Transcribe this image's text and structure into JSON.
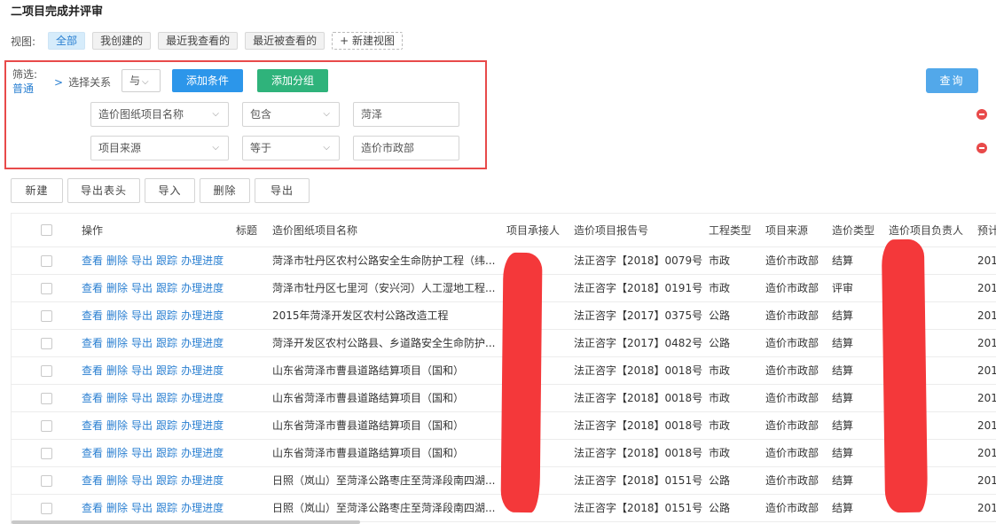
{
  "page": {
    "title": "二项目完成并评审"
  },
  "views": {
    "label": "视图:",
    "items": [
      "全部",
      "我创建的",
      "最近我查看的",
      "最近被查看的"
    ],
    "new_view": "+ 新建视图"
  },
  "filter": {
    "label": "筛选:",
    "mode": "普通",
    "relation_label": "选择关系",
    "relation_value": "与",
    "add_condition": "添加条件",
    "add_group": "添加分组",
    "conditions": [
      {
        "field": "造价图纸项目名称",
        "operator": "包含",
        "value": "菏泽"
      },
      {
        "field": "项目来源",
        "operator": "等于",
        "value": "造价市政部"
      }
    ],
    "query": "查询"
  },
  "toolbar": {
    "new": "新建",
    "export_header": "导出表头",
    "import": "导入",
    "delete": "删除",
    "export": "导出"
  },
  "table": {
    "columns": [
      "操作",
      "标题",
      "造价图纸项目名称",
      "项目承接人",
      "造价项目报告号",
      "工程类型",
      "项目来源",
      "造价类型",
      "造价项目负责人",
      "预计"
    ],
    "actions": [
      "查看",
      "删除",
      "导出",
      "跟踪",
      "办理进度"
    ],
    "rows": [
      {
        "name": "菏泽市牡丹区农村公路安全生命防护工程（纬...",
        "report": "法正咨字【2018】0079号",
        "type": "市政",
        "source": "造价市政部",
        "cost_type": "结算",
        "date": "201"
      },
      {
        "name": "菏泽市牡丹区七里河（安兴河）人工湿地工程...",
        "report": "法正咨字【2018】0191号",
        "type": "市政",
        "source": "造价市政部",
        "cost_type": "评审",
        "date": "201"
      },
      {
        "name": "2015年菏泽开发区农村公路改造工程",
        "report": "法正咨字【2017】0375号",
        "type": "公路",
        "source": "造价市政部",
        "cost_type": "结算",
        "date": "201"
      },
      {
        "name": "菏泽开发区农村公路县、乡道路安全生命防护...",
        "report": "法正咨字【2017】0482号",
        "type": "公路",
        "source": "造价市政部",
        "cost_type": "结算",
        "date": "201"
      },
      {
        "name": "山东省菏泽市曹县道路结算项目（国和）",
        "report": "法正咨字【2018】0018号",
        "type": "市政",
        "source": "造价市政部",
        "cost_type": "结算",
        "date": "201"
      },
      {
        "name": "山东省菏泽市曹县道路结算项目（国和）",
        "report": "法正咨字【2018】0018号",
        "type": "市政",
        "source": "造价市政部",
        "cost_type": "结算",
        "date": "201"
      },
      {
        "name": "山东省菏泽市曹县道路结算项目（国和）",
        "report": "法正咨字【2018】0018号",
        "type": "市政",
        "source": "造价市政部",
        "cost_type": "结算",
        "date": "201"
      },
      {
        "name": "山东省菏泽市曹县道路结算项目（国和）",
        "report": "法正咨字【2018】0018号",
        "type": "市政",
        "source": "造价市政部",
        "cost_type": "结算",
        "date": "201"
      },
      {
        "name": "日照（岚山）至菏泽公路枣庄至菏泽段南四湖...",
        "report": "法正咨字【2018】0151号",
        "type": "公路",
        "source": "造价市政部",
        "cost_type": "结算",
        "date": "201"
      },
      {
        "name": "日照（岚山）至菏泽公路枣庄至菏泽段南四湖...",
        "report": "法正咨字【2018】0151号",
        "type": "公路",
        "source": "造价市政部",
        "cost_type": "结算",
        "date": "201"
      }
    ]
  },
  "colors": {
    "accent": "#2c96ea",
    "green": "#2fb37b",
    "highlight": "#e84a4a",
    "redaction": "#f4383a"
  }
}
